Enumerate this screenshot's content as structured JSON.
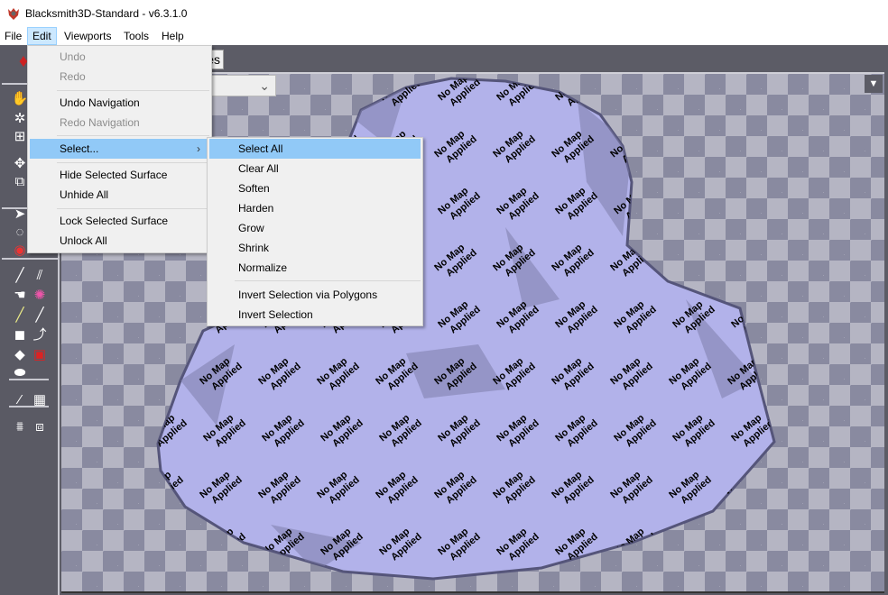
{
  "title": "Blacksmith3D-Standard - v6.3.1.0",
  "menubar": [
    "File",
    "Edit",
    "Viewports",
    "Tools",
    "Help"
  ],
  "tab_label": "es",
  "viewport": {
    "dropdown_chevron": "⌄",
    "corner_button": "▼",
    "texture_label_line1": "No Map",
    "texture_label_line2": "Applied",
    "colors": {
      "mesh": "#b2b2ea",
      "checker_dark": "#898aa0",
      "checker_light": "#b5b5c3"
    }
  },
  "edit_menu": {
    "items": [
      {
        "label": "Undo",
        "disabled": true
      },
      {
        "label": "Redo",
        "disabled": true
      },
      {
        "label": "Undo Navigation",
        "disabled": false
      },
      {
        "label": "Redo Navigation",
        "disabled": true
      },
      {
        "label": "Select...",
        "submenu": true,
        "highlighted": true
      },
      {
        "label": "Hide Selected Surface"
      },
      {
        "label": "Unhide All"
      },
      {
        "label": "Lock Selected Surface"
      },
      {
        "label": "Unlock All"
      }
    ]
  },
  "select_submenu": {
    "items": [
      "Select All",
      "Clear All",
      "Soften",
      "Harden",
      "Grow",
      "Shrink",
      "Normalize",
      "Invert Selection via Polygons",
      "Invert Selection"
    ],
    "highlighted": "Select All"
  },
  "toolbar_icons": [
    "hand-icon",
    "orbit-icon",
    "zoom-fit-icon",
    "move-icon",
    "scale-icon",
    "pointer-icon",
    "lasso-icon",
    "paint-select-icon",
    "brush-icon",
    "double-brush-icon",
    "smudge-icon",
    "color-brush-icon",
    "light-brush-icon",
    "etc-brush-icon",
    "shapes-icon",
    "path-pointer-icon",
    "fill-icon",
    "layer-icon",
    "eraser-icon",
    "eyedropper-icon",
    "pattern-icon",
    "projection-icon",
    "swap-texture-icon"
  ],
  "arrow": "›"
}
